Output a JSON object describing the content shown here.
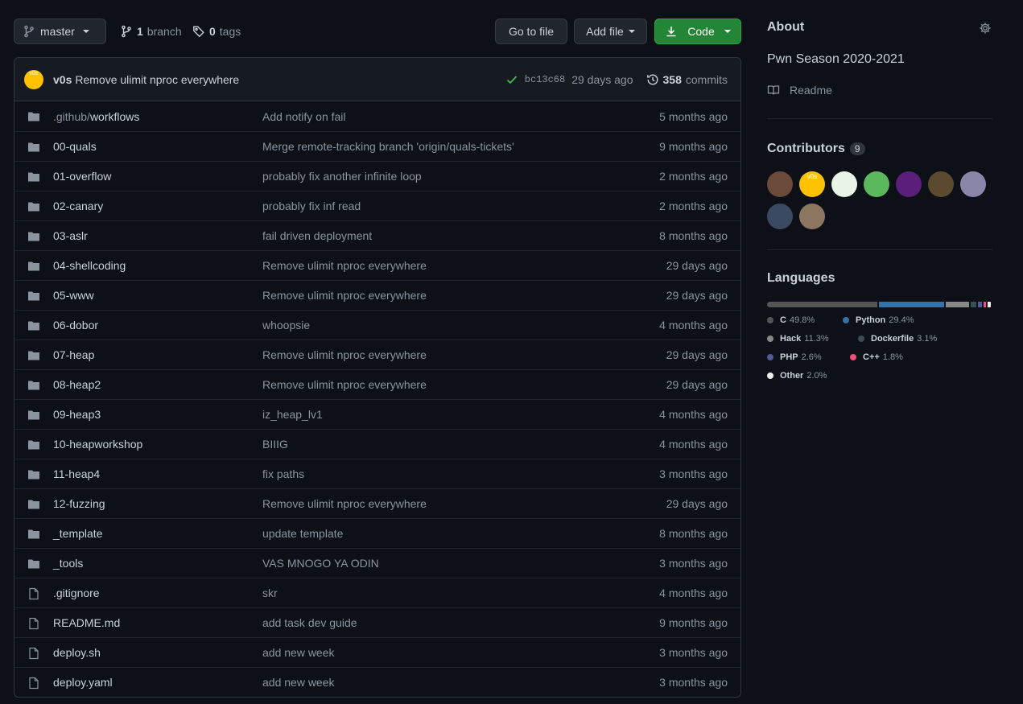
{
  "toolbar": {
    "branch_name": "master",
    "branches_count": "1",
    "branches_label": "branch",
    "tags_count": "0",
    "tags_label": "tags",
    "goto_label": "Go to file",
    "add_file_label": "Add file",
    "code_label": "Code"
  },
  "commit": {
    "avatar_text": "v0s",
    "author": "v0s",
    "message": "Remove ulimit nproc everywhere",
    "sha": "bc13c68",
    "time": "29 days ago",
    "commits_count": "358",
    "commits_label": "commits"
  },
  "files": [
    {
      "prefix": ".github/",
      "name": "workflows",
      "type": "dir",
      "message": "Add notify on fail",
      "age": "5 months ago"
    },
    {
      "prefix": "",
      "name": "00-quals",
      "type": "dir",
      "message": "Merge remote-tracking branch 'origin/quals-tickets'",
      "age": "9 months ago"
    },
    {
      "prefix": "",
      "name": "01-overflow",
      "type": "dir",
      "message": "probably fix another infinite loop",
      "age": "2 months ago"
    },
    {
      "prefix": "",
      "name": "02-canary",
      "type": "dir",
      "message": "probably fix inf read",
      "age": "2 months ago"
    },
    {
      "prefix": "",
      "name": "03-aslr",
      "type": "dir",
      "message": "fail driven deployment",
      "age": "8 months ago"
    },
    {
      "prefix": "",
      "name": "04-shellcoding",
      "type": "dir",
      "message": "Remove ulimit nproc everywhere",
      "age": "29 days ago"
    },
    {
      "prefix": "",
      "name": "05-www",
      "type": "dir",
      "message": "Remove ulimit nproc everywhere",
      "age": "29 days ago"
    },
    {
      "prefix": "",
      "name": "06-dobor",
      "type": "dir",
      "message": "whoopsie",
      "age": "4 months ago"
    },
    {
      "prefix": "",
      "name": "07-heap",
      "type": "dir",
      "message": "Remove ulimit nproc everywhere",
      "age": "29 days ago"
    },
    {
      "prefix": "",
      "name": "08-heap2",
      "type": "dir",
      "message": "Remove ulimit nproc everywhere",
      "age": "29 days ago"
    },
    {
      "prefix": "",
      "name": "09-heap3",
      "type": "dir",
      "message": "iz_heap_lv1",
      "age": "4 months ago"
    },
    {
      "prefix": "",
      "name": "10-heapworkshop",
      "type": "dir",
      "message": "BIIIG",
      "age": "4 months ago"
    },
    {
      "prefix": "",
      "name": "11-heap4",
      "type": "dir",
      "message": "fix paths",
      "age": "3 months ago"
    },
    {
      "prefix": "",
      "name": "12-fuzzing",
      "type": "dir",
      "message": "Remove ulimit nproc everywhere",
      "age": "29 days ago"
    },
    {
      "prefix": "",
      "name": "_template",
      "type": "dir",
      "message": "update template",
      "age": "8 months ago"
    },
    {
      "prefix": "",
      "name": "_tools",
      "type": "dir",
      "message": "VAS MNOGO YA ODIN",
      "age": "3 months ago"
    },
    {
      "prefix": "",
      "name": ".gitignore",
      "type": "file",
      "message": "skr",
      "age": "4 months ago"
    },
    {
      "prefix": "",
      "name": "README.md",
      "type": "file",
      "message": "add task dev guide",
      "age": "9 months ago"
    },
    {
      "prefix": "",
      "name": "deploy.sh",
      "type": "file",
      "message": "add new week",
      "age": "3 months ago"
    },
    {
      "prefix": "",
      "name": "deploy.yaml",
      "type": "file",
      "message": "add new week",
      "age": "3 months ago"
    }
  ],
  "sidebar": {
    "about_title": "About",
    "description": "Pwn Season 2020-2021",
    "readme_label": "Readme",
    "contributors_title": "Contributors",
    "contributors_count": "9",
    "contributor_avatars": [
      {
        "color": "#6b4a3a",
        "text": ""
      },
      {
        "color": "#ffc200",
        "text": "v0s"
      },
      {
        "color": "#e8f5e8",
        "text": ""
      },
      {
        "color": "#5cb85c",
        "text": ""
      },
      {
        "color": "#5a1f7a",
        "text": ""
      },
      {
        "color": "#5b4a2e",
        "text": ""
      },
      {
        "color": "#8a86a8",
        "text": ""
      },
      {
        "color": "#3b4a63",
        "text": ""
      },
      {
        "color": "#8c7660",
        "text": ""
      }
    ],
    "languages_title": "Languages",
    "languages": [
      {
        "name": "C",
        "percent": "49.8%",
        "value": 49.8,
        "color": "#555555"
      },
      {
        "name": "Python",
        "percent": "29.4%",
        "value": 29.4,
        "color": "#3572A5"
      },
      {
        "name": "Hack",
        "percent": "11.3%",
        "value": 11.3,
        "color": "#878787"
      },
      {
        "name": "Dockerfile",
        "percent": "3.1%",
        "value": 3.1,
        "color": "#384d54"
      },
      {
        "name": "PHP",
        "percent": "2.6%",
        "value": 2.6,
        "color": "#4F5D95"
      },
      {
        "name": "C++",
        "percent": "1.8%",
        "value": 1.8,
        "color": "#f34b7d"
      },
      {
        "name": "Other",
        "percent": "2.0%",
        "value": 2.0,
        "color": "#ededed"
      }
    ]
  },
  "colors": {
    "background": "#0d1117",
    "accent_green": "#238636",
    "check_green": "#3fb950"
  }
}
